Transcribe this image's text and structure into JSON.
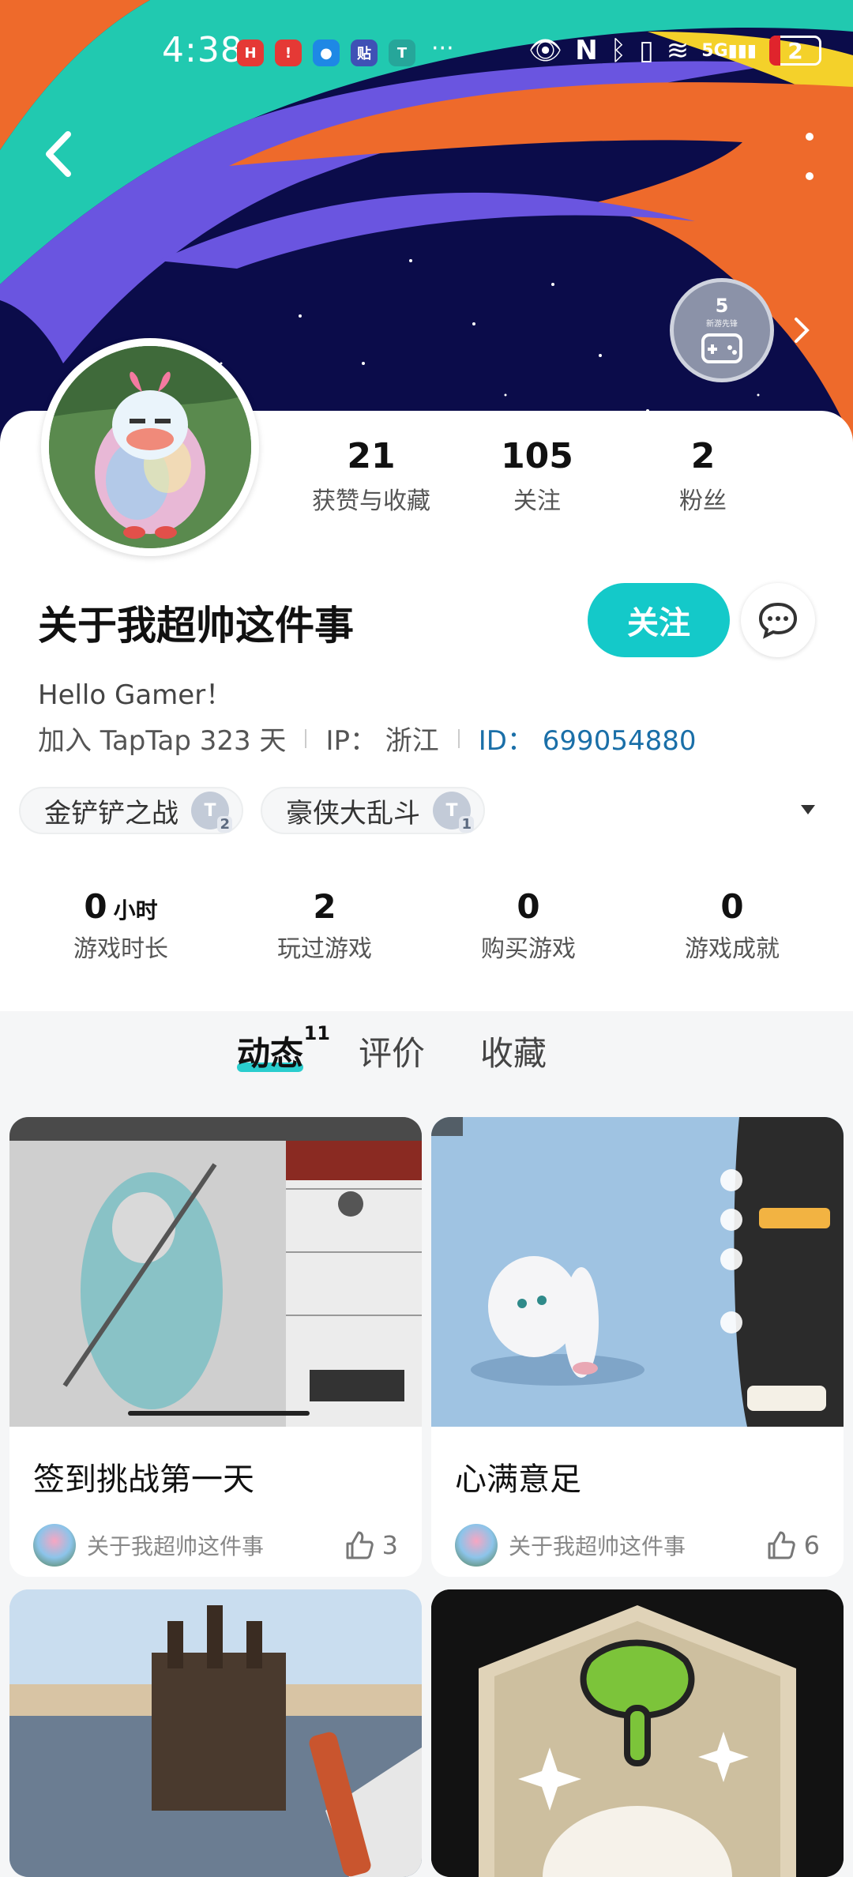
{
  "status_bar": {
    "time": "4:38",
    "network": "5G",
    "battery": "2"
  },
  "banner": {
    "achievement_badge": {
      "number": "5",
      "label": "新游先锋"
    }
  },
  "profile": {
    "name": "关于我超帅这件事",
    "bio": "Hello Gamer！",
    "joined": "加入 TapTap 323 天",
    "ip": "IP： 浙江",
    "id": "ID： 699054880",
    "follow_label": "关注",
    "stats": [
      {
        "value": "21",
        "label": "获赞与收藏"
      },
      {
        "value": "105",
        "label": "关注"
      },
      {
        "value": "2",
        "label": "粉丝"
      }
    ],
    "game_tags": [
      {
        "name": "金铲铲之战",
        "level": "2"
      },
      {
        "name": "豪侠大乱斗",
        "level": "1"
      }
    ]
  },
  "game_stats": [
    {
      "value": "0",
      "unit": "小时",
      "label": "游戏时长"
    },
    {
      "value": "2",
      "unit": "",
      "label": "玩过游戏"
    },
    {
      "value": "0",
      "unit": "",
      "label": "购买游戏"
    },
    {
      "value": "0",
      "unit": "",
      "label": "游戏成就"
    }
  ],
  "tabs": [
    {
      "label": "动态",
      "count": "11",
      "active": true
    },
    {
      "label": "评价",
      "count": "",
      "active": false
    },
    {
      "label": "收藏",
      "count": "",
      "active": false
    }
  ],
  "posts": [
    {
      "title": "签到挑战第一天",
      "author": "关于我超帅这件事",
      "likes": "3"
    },
    {
      "title": "心满意足",
      "author": "关于我超帅这件事",
      "likes": "6"
    }
  ],
  "colors": {
    "accent": "#14c9c9",
    "banner_bg": "#0b0c4a",
    "id_link": "#1a6fa8"
  }
}
